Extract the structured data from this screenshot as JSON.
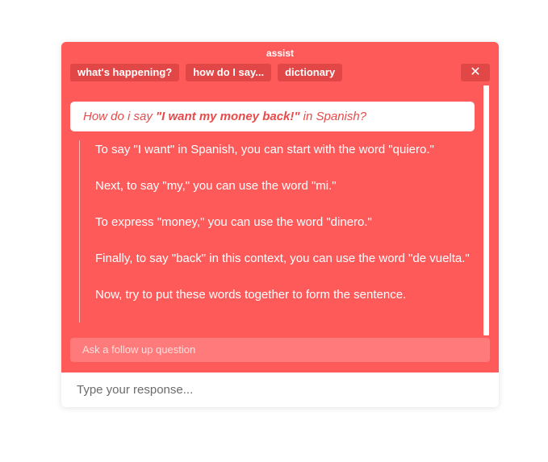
{
  "header": {
    "title": "assist",
    "tabs": [
      "what's happening?",
      "how do I say...",
      "dictionary"
    ],
    "close_label": "✕"
  },
  "conversation": {
    "question": {
      "prefix": "How do i say ",
      "phrase": "\"I want my money back!\"",
      "suffix": " in Spanish?"
    },
    "answer_paragraphs": [
      "To say \"I want\" in Spanish, you can start with the word \"quiero.\"",
      "Next, to say \"my,\" you can use the word \"mi.\"",
      "To express \"money,\" you can use the word \"dinero.\"",
      "Finally, to say \"back\" in this context, you can use the word \"de vuelta.\"",
      "Now, try to put these words together to form the sentence."
    ]
  },
  "followup": {
    "placeholder": "Ask a follow up question"
  },
  "response": {
    "placeholder": "Type your response..."
  },
  "colors": {
    "panel": "#ff5a5a",
    "tab": "#e14747",
    "question_text": "#e84a4a"
  }
}
